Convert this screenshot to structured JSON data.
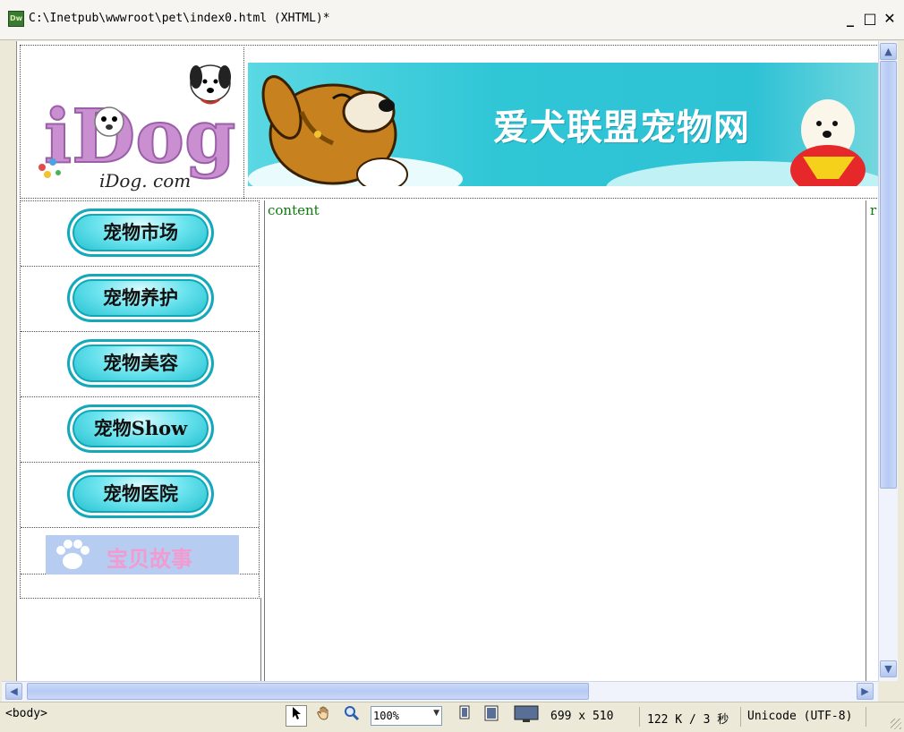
{
  "window": {
    "title": "C:\\Inetpub\\wwwroot\\pet\\index0.html (XHTML)*",
    "app_icon_text": "Dw",
    "minimize": "_",
    "maximize": "□",
    "close": "✕"
  },
  "page": {
    "logo": {
      "big": "iDog",
      "small": "iDog. com"
    },
    "banner_text": "爱犬联盟宠物网",
    "nav": [
      {
        "label": "宠物市场"
      },
      {
        "label": "宠物养护"
      },
      {
        "label": "宠物美容"
      },
      {
        "label": "宠物Show"
      },
      {
        "label": "宠物医院"
      }
    ],
    "story_label": "宝贝故事",
    "content_placeholder": "content",
    "right_placeholder": "r"
  },
  "scroll": {
    "up": "▲",
    "down": "▼",
    "left": "◀",
    "right": "▶"
  },
  "status": {
    "tag_selector": "<body>",
    "zoom": "100%",
    "window_size": "699 x 510",
    "download": "122 K / 3 秒",
    "encoding": "Unicode (UTF-8)"
  },
  "colors": {
    "banner": "#2ec2d5",
    "nav_button": "#17b9c9",
    "story_bg": "#b6cdf1",
    "content_text": "#0f7a0f"
  }
}
